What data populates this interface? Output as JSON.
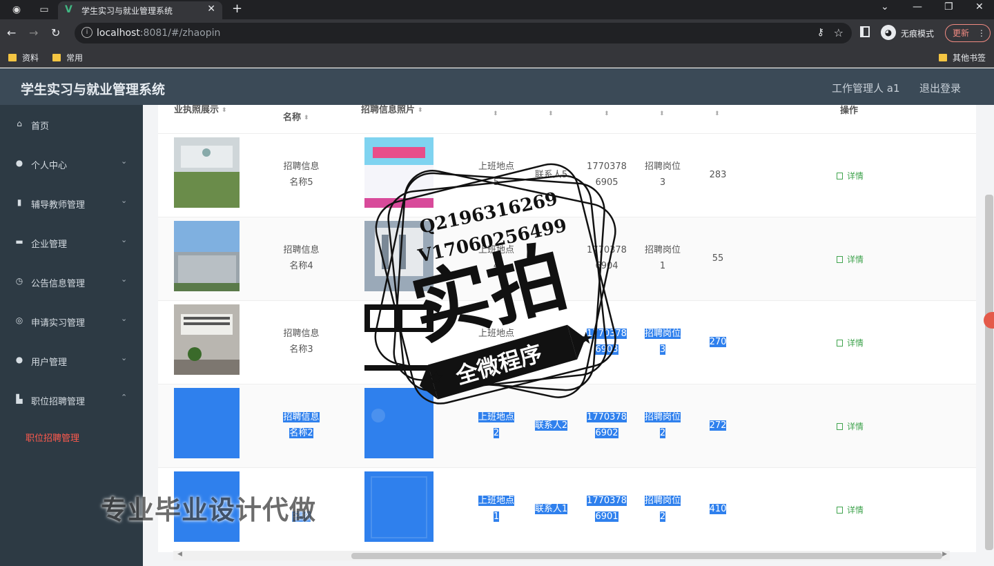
{
  "browser": {
    "tab_title": "学生实习与就业管理系统",
    "url_host": "localhost",
    "url_rest": ":8081/#/zhaopin",
    "incognito_label": "无痕模式",
    "update_label": "更新",
    "bookmarks": [
      "资料",
      "常用"
    ],
    "other_bookmarks": "其他书签"
  },
  "header": {
    "title": "学生实习与就业管理系统",
    "user": "工作管理人 a1",
    "logout": "退出登录"
  },
  "sidebar": {
    "items": [
      {
        "label": "首页",
        "icon": "home-icon"
      },
      {
        "label": "个人中心",
        "icon": "user-icon"
      },
      {
        "label": "辅导教师管理",
        "icon": "bar-chart-icon"
      },
      {
        "label": "企业管理",
        "icon": "briefcase-icon"
      },
      {
        "label": "公告信息管理",
        "icon": "clock-icon"
      },
      {
        "label": "申请实习管理",
        "icon": "target-icon"
      },
      {
        "label": "用户管理",
        "icon": "user-icon"
      },
      {
        "label": "职位招聘管理",
        "icon": "building-icon"
      }
    ],
    "active_sub": "职位招聘管理"
  },
  "table": {
    "headers": {
      "license": "业执照展示",
      "name": "名称",
      "photo": "招聘信息照片",
      "actions": "操作"
    },
    "detail_label": "详情",
    "rows": [
      {
        "name1": "招聘信息",
        "name2": "名称5",
        "loc1": "上班地点",
        "loc2": "5",
        "contact": "联系人5",
        "phone1": "1770378",
        "phone2": "6905",
        "pos1": "招聘岗位",
        "pos2": "3",
        "num": "283"
      },
      {
        "name1": "招聘信息",
        "name2": "名称4",
        "loc1": "上班地点",
        "loc2": "4",
        "contact": "",
        "phone1": "1770378",
        "phone2": "6904",
        "pos1": "招聘岗位",
        "pos2": "1",
        "num": "55"
      },
      {
        "name1": "招聘信息",
        "name2": "名称3",
        "loc1": "上班地点",
        "loc2": "",
        "contact": "",
        "phone1": "1770378",
        "phone2": "6903",
        "pos1": "招聘岗位",
        "pos2": "3",
        "num": "270"
      },
      {
        "name1": "招聘信息",
        "name2": "名称2",
        "loc1": "上班地点",
        "loc2": "2",
        "contact": "联系人2",
        "phone1": "1770378",
        "phone2": "6902",
        "pos1": "招聘岗位",
        "pos2": "2",
        "num": "272"
      },
      {
        "name1": "",
        "name2": "名称",
        "loc1": "上班地点",
        "loc2": "1",
        "contact": "联系人1",
        "phone1": "1770378",
        "phone2": "6901",
        "pos1": "招聘岗位",
        "pos2": "2",
        "num": "410"
      }
    ]
  },
  "watermark": {
    "q": "Q2196316269",
    "v": "V17060256499",
    "big": "实拍",
    "banner": "全微程序",
    "bottom": "专业毕业设计代做"
  }
}
